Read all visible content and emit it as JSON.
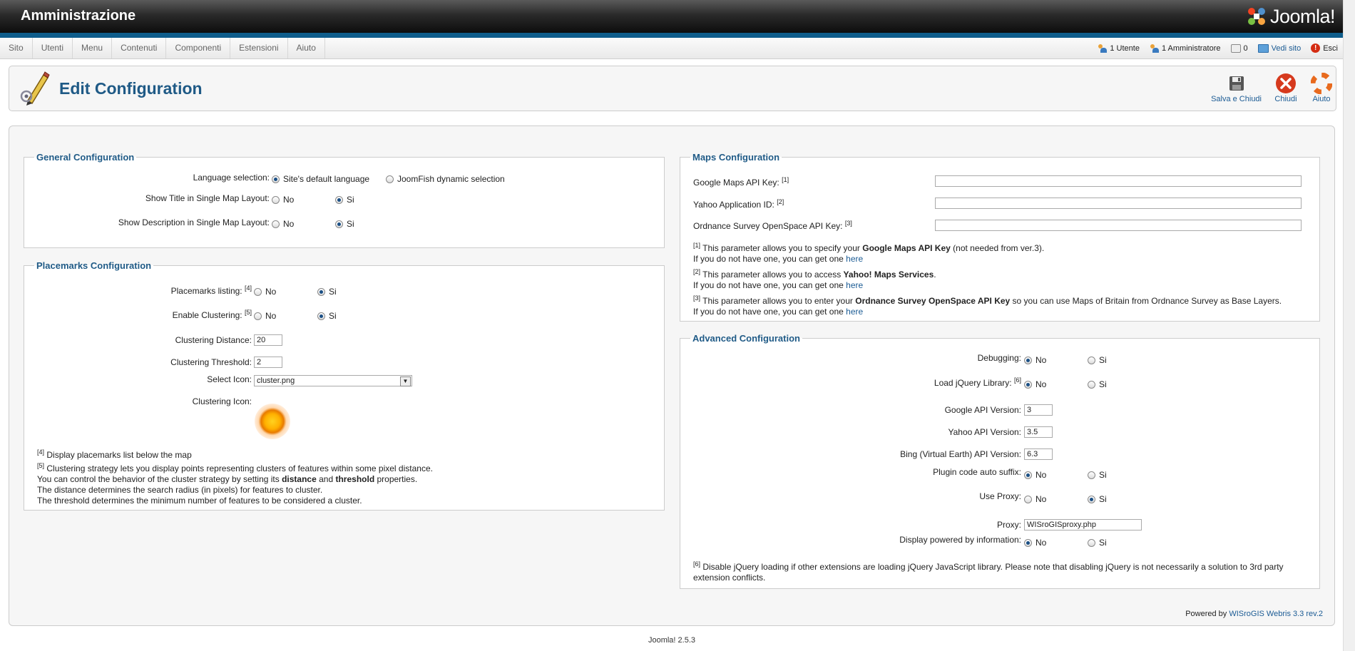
{
  "header": {
    "title": "Amministrazione",
    "brand": "Joomla!"
  },
  "menu": [
    "Sito",
    "Utenti",
    "Menu",
    "Contenuti",
    "Componenti",
    "Estensioni",
    "Aiuto"
  ],
  "status": {
    "users": "1 Utente",
    "admins": "1 Amministratore",
    "messages": "0",
    "view_site": "Vedi sito",
    "logout": "Esci"
  },
  "toolbar": {
    "title": "Edit Configuration",
    "save_close": "Salva e Chiudi",
    "close": "Chiudi",
    "help": "Aiuto"
  },
  "general": {
    "legend": "General Configuration",
    "language_label": "Language selection:",
    "language_opt1": "Site's default language",
    "language_opt2": "JoomFish dynamic selection",
    "show_title_label": "Show Title in Single Map Layout:",
    "show_desc_label": "Show Description in Single Map Layout:",
    "no": "No",
    "si": "Si"
  },
  "placemarks": {
    "legend": "Placemarks Configuration",
    "listing_label": "Placemarks listing:",
    "listing_ref": "[4]",
    "clustering_label": "Enable Clustering:",
    "clustering_ref": "[5]",
    "distance_label": "Clustering Distance:",
    "distance_value": "20",
    "threshold_label": "Clustering Threshold:",
    "threshold_value": "2",
    "icon_label": "Select Icon:",
    "icon_value": "cluster.png",
    "cluster_icon_label": "Clustering Icon:",
    "note4_ref": "[4]",
    "note4": "Display placemarks list below the map",
    "note5_ref": "[5]",
    "note5_l1": "Clustering strategy lets you display points representing clusters of features within some pixel distance.",
    "note5_l2a": "You can control the behavior of the cluster strategy by setting its ",
    "note5_l2b": "distance",
    "note5_l2c": " and ",
    "note5_l2d": "threshold",
    "note5_l2e": " properties.",
    "note5_l3": "The distance determines the search radius (in pixels) for features to cluster.",
    "note5_l4": "The threshold determines the minimum number of features to be considered a cluster."
  },
  "maps": {
    "legend": "Maps Configuration",
    "google_label": "Google Maps API Key:",
    "google_ref": "[1]",
    "yahoo_label": "Yahoo Application ID:",
    "yahoo_ref": "[2]",
    "os_label": "Ordnance Survey OpenSpace API Key:",
    "os_ref": "[3]",
    "n1_ref": "[1]",
    "n1_a": " This parameter allows you to specify your ",
    "n1_b": "Google Maps API Key",
    "n1_c": " (not needed from ver.3).",
    "n2_ref": "[2]",
    "n2_a": " This parameter allows you to access ",
    "n2_b": "Yahoo! Maps Services",
    "n2_c": ".",
    "n3_ref": "[3]",
    "n3_a": " This parameter allows you to enter your ",
    "n3_b": "Ordnance Survey OpenSpace API Key",
    "n3_c": " so you can use Maps of Britain from Ordnance Survey as Base Layers.",
    "getone": "If you do not have one, you can get one ",
    "here": "here"
  },
  "advanced": {
    "legend": "Advanced Configuration",
    "debug_label": "Debugging:",
    "jquery_label": "Load jQuery Library:",
    "jquery_ref": "[6]",
    "gapi_label": "Google API Version:",
    "gapi_value": "3",
    "yapi_label": "Yahoo API Version:",
    "yapi_value": "3.5",
    "bapi_label": "Bing (Virtual Earth) API Version:",
    "bapi_value": "6.3",
    "suffix_label": "Plugin code auto suffix:",
    "proxy_use_label": "Use Proxy:",
    "proxy_label": "Proxy:",
    "proxy_value": "WISroGISproxy.php",
    "powered_label": "Display powered by information:",
    "n6_ref": "[6]",
    "n6_l1": " Disable jQuery loading if other extensions are loading jQuery JavaScript library. Please note that disabling jQuery is not necessarily a solution to 3rd party",
    "n6_l2": "extension conflicts.",
    "no": "No",
    "si": "Si"
  },
  "powered": {
    "prefix": "Powered by ",
    "link": "WISroGIS Webris 3.3 rev.2"
  },
  "footer": "Joomla! 2.5.3"
}
